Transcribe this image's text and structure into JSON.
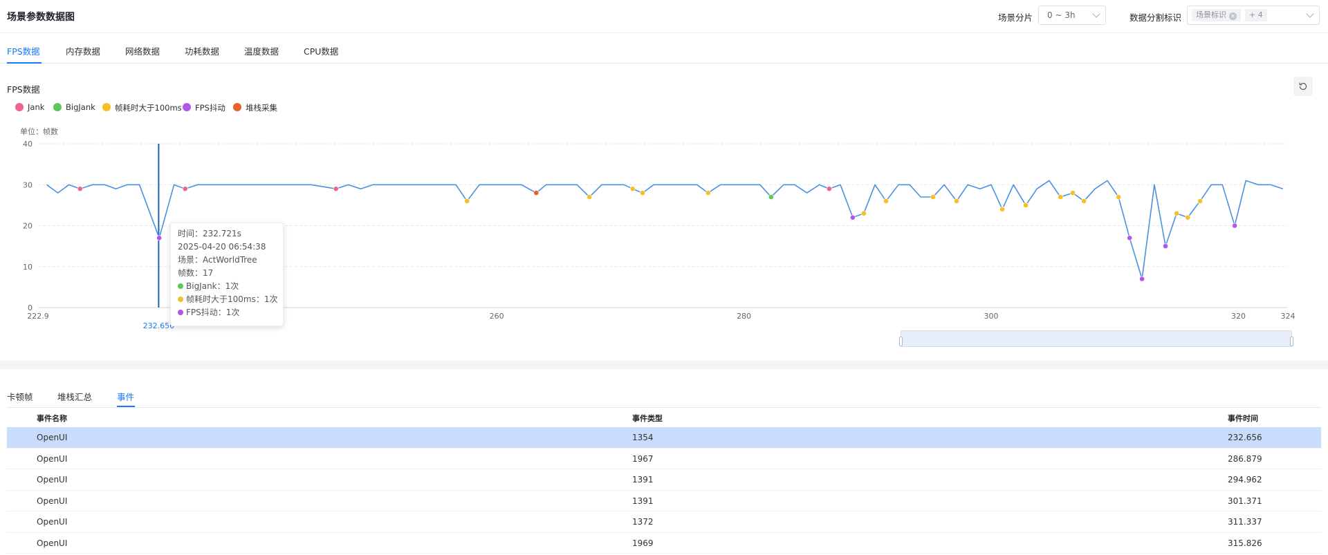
{
  "header": {
    "title": "场景参数数据图",
    "scene_split_label": "场景分片",
    "scene_split_value": "0 ~ 3h",
    "data_split_label": "数据分割标识",
    "data_split_tag": "场景标识",
    "data_split_more": "+ 4"
  },
  "tabs": [
    {
      "label": "FPS数据",
      "active": true
    },
    {
      "label": "内存数据",
      "active": false
    },
    {
      "label": "网络数据",
      "active": false
    },
    {
      "label": "功耗数据",
      "active": false
    },
    {
      "label": "温度数据",
      "active": false
    },
    {
      "label": "CPU数据",
      "active": false
    }
  ],
  "chart_section": {
    "title": "FPS数据",
    "unit_label": "单位：帧数",
    "legend": [
      {
        "label": "Jank",
        "color": "#f06292"
      },
      {
        "label": "BigJank",
        "color": "#5cc85c"
      },
      {
        "label": "帧耗时大于100ms",
        "color": "#f5c026"
      },
      {
        "label": "FPS抖动",
        "color": "#b157e8"
      },
      {
        "label": "堆栈采集",
        "color": "#e8622a"
      }
    ],
    "cursor_label": "232.656",
    "tooltip": {
      "time": "时间：232.721s",
      "datetime": "2025-04-20 06:54:38",
      "scene": "场景：ActWorldTree",
      "frames": "帧数：17",
      "items": [
        {
          "label": "BigJank：1次",
          "color": "#5cc85c"
        },
        {
          "label": "帧耗时大于100ms：1次",
          "color": "#f5c026"
        },
        {
          "label": "FPS抖动：1次",
          "color": "#b157e8"
        }
      ]
    }
  },
  "chart_data": {
    "type": "line",
    "title": "FPS数据",
    "ylabel": "单位：帧数",
    "xlim": [
      222.9,
      324
    ],
    "ylim": [
      0,
      40
    ],
    "y_ticks": [
      0,
      10,
      20,
      30,
      40
    ],
    "x_tick_labels": [
      "222.9",
      "260",
      "280",
      "300",
      "320",
      "324"
    ],
    "x_ticks": [
      222.9,
      260,
      280,
      300,
      320,
      324
    ],
    "grid": true,
    "legend_position": "top-left",
    "line_color": "#4a90e2",
    "series": [
      {
        "points": [
          [
            223.6,
            30
          ],
          [
            224.5,
            28
          ],
          [
            225.4,
            30
          ],
          [
            226.3,
            29
          ],
          [
            227.3,
            30
          ],
          [
            228.3,
            30
          ],
          [
            229.2,
            29
          ],
          [
            230.1,
            30
          ],
          [
            231.1,
            30
          ],
          [
            232.7,
            17
          ],
          [
            233.9,
            30
          ],
          [
            234.8,
            29
          ],
          [
            235.8,
            30
          ],
          [
            240,
            30
          ],
          [
            245,
            30
          ],
          [
            247,
            29
          ],
          [
            248,
            30
          ],
          [
            249,
            29
          ],
          [
            250,
            30
          ],
          [
            255,
            30
          ],
          [
            256.7,
            30
          ],
          [
            257.6,
            26
          ],
          [
            258.6,
            30
          ],
          [
            262,
            30
          ],
          [
            263.2,
            28
          ],
          [
            264,
            30
          ],
          [
            266.5,
            30
          ],
          [
            267.5,
            27
          ],
          [
            268.5,
            30
          ],
          [
            270.3,
            30
          ],
          [
            271,
            29
          ],
          [
            271.8,
            28
          ],
          [
            272.7,
            30
          ],
          [
            276.2,
            30
          ],
          [
            277.1,
            28
          ],
          [
            278.1,
            30
          ],
          [
            281.3,
            30
          ],
          [
            282.2,
            27
          ],
          [
            283.2,
            30
          ],
          [
            284.1,
            30
          ],
          [
            285.1,
            28
          ],
          [
            286.1,
            30
          ],
          [
            286.9,
            29
          ],
          [
            287.8,
            30
          ],
          [
            288.8,
            22
          ],
          [
            289.7,
            23
          ],
          [
            290.6,
            30
          ],
          [
            291.5,
            26
          ],
          [
            292.5,
            30
          ],
          [
            293.4,
            30
          ],
          [
            294.3,
            27
          ],
          [
            295.3,
            27
          ],
          [
            296.2,
            30
          ],
          [
            297.2,
            26
          ],
          [
            298.1,
            30
          ],
          [
            299.1,
            29
          ],
          [
            300,
            30
          ],
          [
            300.9,
            24
          ],
          [
            301.8,
            30
          ],
          [
            302.8,
            25
          ],
          [
            303.7,
            29
          ],
          [
            304.7,
            31
          ],
          [
            305.6,
            27
          ],
          [
            306.6,
            28
          ],
          [
            307.5,
            26
          ],
          [
            308.4,
            29
          ],
          [
            309.4,
            31
          ],
          [
            310.3,
            27
          ],
          [
            311.2,
            17
          ],
          [
            312.2,
            7
          ],
          [
            313.2,
            30
          ],
          [
            314.1,
            15
          ],
          [
            315,
            23
          ],
          [
            315.9,
            22
          ],
          [
            316.9,
            26
          ],
          [
            317.8,
            30
          ],
          [
            318.7,
            30
          ],
          [
            319.7,
            20
          ],
          [
            320.6,
            31
          ],
          [
            321.6,
            30
          ],
          [
            322.6,
            30
          ],
          [
            323.6,
            29
          ]
        ]
      }
    ],
    "markers": [
      {
        "x": 226.3,
        "y": 29,
        "type": "Jank"
      },
      {
        "x": 232.7,
        "y": 17,
        "type": "FPS抖动"
      },
      {
        "x": 234.8,
        "y": 29,
        "type": "Jank"
      },
      {
        "x": 247,
        "y": 29,
        "type": "Jank"
      },
      {
        "x": 257.6,
        "y": 26,
        "type": "帧耗时大于100ms"
      },
      {
        "x": 263.2,
        "y": 28,
        "type": "堆栈采集"
      },
      {
        "x": 267.5,
        "y": 27,
        "type": "帧耗时大于100ms"
      },
      {
        "x": 271,
        "y": 29,
        "type": "帧耗时大于100ms"
      },
      {
        "x": 271.8,
        "y": 28,
        "type": "帧耗时大于100ms"
      },
      {
        "x": 277.1,
        "y": 28,
        "type": "帧耗时大于100ms"
      },
      {
        "x": 282.2,
        "y": 27,
        "type": "BigJank"
      },
      {
        "x": 286.9,
        "y": 29,
        "type": "Jank"
      },
      {
        "x": 288.8,
        "y": 22,
        "type": "FPS抖动"
      },
      {
        "x": 289.7,
        "y": 23,
        "type": "帧耗时大于100ms"
      },
      {
        "x": 291.5,
        "y": 26,
        "type": "帧耗时大于100ms"
      },
      {
        "x": 295.3,
        "y": 27,
        "type": "帧耗时大于100ms"
      },
      {
        "x": 297.2,
        "y": 26,
        "type": "帧耗时大于100ms"
      },
      {
        "x": 300.9,
        "y": 24,
        "type": "帧耗时大于100ms"
      },
      {
        "x": 302.8,
        "y": 25,
        "type": "帧耗时大于100ms"
      },
      {
        "x": 305.6,
        "y": 27,
        "type": "帧耗时大于100ms"
      },
      {
        "x": 306.6,
        "y": 28,
        "type": "帧耗时大于100ms"
      },
      {
        "x": 307.5,
        "y": 26,
        "type": "帧耗时大于100ms"
      },
      {
        "x": 310.3,
        "y": 27,
        "type": "帧耗时大于100ms"
      },
      {
        "x": 311.2,
        "y": 17,
        "type": "FPS抖动"
      },
      {
        "x": 312.2,
        "y": 7,
        "type": "FPS抖动"
      },
      {
        "x": 314.1,
        "y": 15,
        "type": "FPS抖动"
      },
      {
        "x": 315,
        "y": 23,
        "type": "帧耗时大于100ms"
      },
      {
        "x": 315.9,
        "y": 22,
        "type": "帧耗时大于100ms"
      },
      {
        "x": 316.9,
        "y": 26,
        "type": "帧耗时大于100ms"
      },
      {
        "x": 319.7,
        "y": 20,
        "type": "FPS抖动"
      }
    ],
    "cursor_x": 232.656
  },
  "bottom_tabs": [
    {
      "label": "卡顿帧",
      "active": false
    },
    {
      "label": "堆栈汇总",
      "active": false
    },
    {
      "label": "事件",
      "active": true
    }
  ],
  "table": {
    "columns": [
      "事件名称",
      "事件类型",
      "事件时间"
    ],
    "rows": [
      {
        "name": "OpenUI",
        "type": "1354",
        "time": "232.656",
        "selected": true
      },
      {
        "name": "OpenUI",
        "type": "1967",
        "time": "286.879",
        "selected": false
      },
      {
        "name": "OpenUI",
        "type": "1391",
        "time": "294.962",
        "selected": false
      },
      {
        "name": "OpenUI",
        "type": "1391",
        "time": "301.371",
        "selected": false
      },
      {
        "name": "OpenUI",
        "type": "1372",
        "time": "311.337",
        "selected": false
      },
      {
        "name": "OpenUI",
        "type": "1969",
        "time": "315.826",
        "selected": false
      }
    ]
  }
}
